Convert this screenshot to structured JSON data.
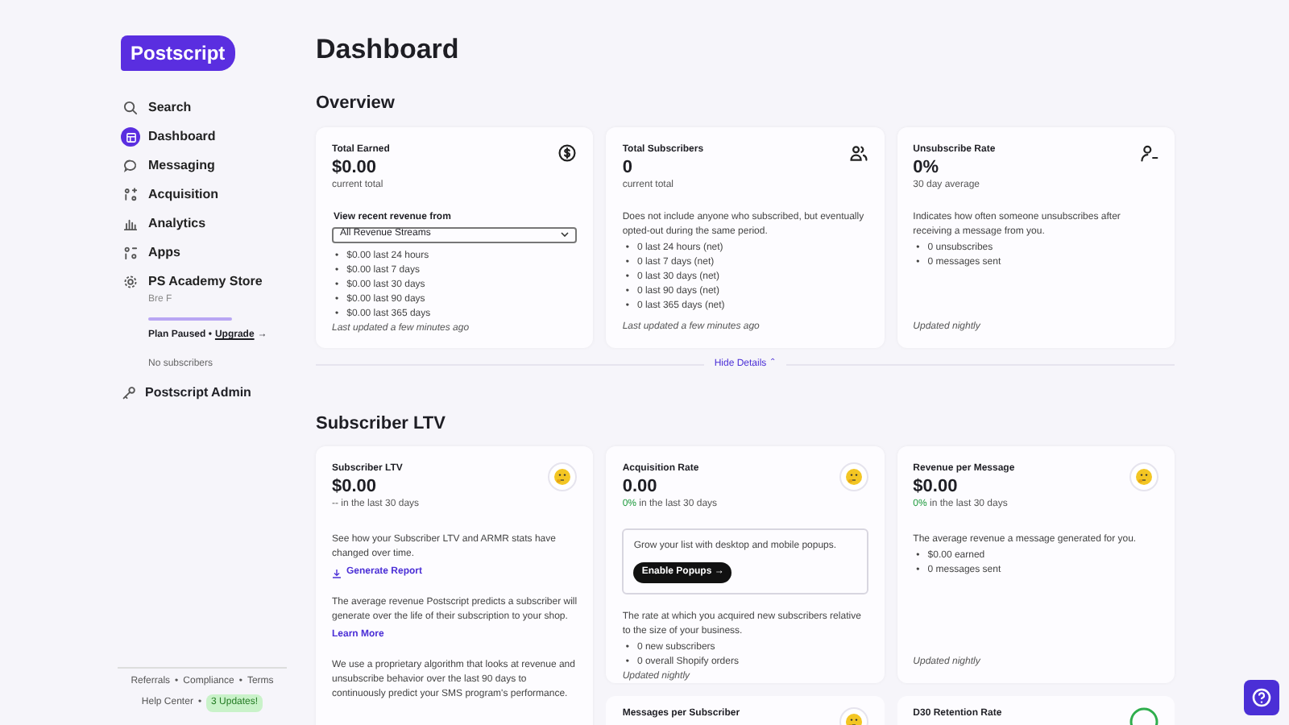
{
  "sidebar": {
    "logo": "Postscript",
    "items": [
      {
        "label": "Search",
        "selected": false
      },
      {
        "label": "Dashboard",
        "selected": true
      },
      {
        "label": "Messaging",
        "selected": false
      },
      {
        "label": "Acquisition",
        "selected": false
      },
      {
        "label": "Analytics",
        "selected": false
      },
      {
        "label": "Apps",
        "selected": false
      },
      {
        "label": "PS Academy Store",
        "selected": false
      }
    ],
    "store": {
      "owner": "Bre F",
      "plan": "Plan Paused •",
      "upgrade": "Upgrade",
      "upgrade_arrow": "→",
      "subscribers": "No subscribers"
    },
    "admin": {
      "label": "Postscript Admin"
    },
    "footer_links": [
      "Referrals",
      "•",
      "Compliance",
      "•",
      "Terms"
    ],
    "help": "Help Center",
    "dot": "•",
    "updates": "3 Updates!"
  },
  "page_title": "Dashboard",
  "overview": {
    "heading": "Overview",
    "cards": [
      {
        "title": "Total Earned",
        "value": "$0.00",
        "caption": "current total",
        "select_label": "View recent revenue from",
        "select_value": "All Revenue Streams",
        "items": [
          {
            "bullet": "•",
            "text": "$0.00 last 24 hours"
          },
          {
            "bullet": "•",
            "text": "$0.00 last 7 days"
          },
          {
            "bullet": "•",
            "text": "$0.00 last 30 days"
          },
          {
            "bullet": "•",
            "text": "$0.00 last 90 days"
          },
          {
            "bullet": "•",
            "text": "$0.00 last 365 days"
          }
        ],
        "footnote": "Last updated a few minutes ago"
      },
      {
        "title": "Total Subscribers",
        "value": "0",
        "caption": "current total",
        "description": "Does not include anyone who subscribed, but eventually opted-out during the same period.",
        "items": [
          {
            "bullet": "•",
            "text": "0 last 24 hours (net)"
          },
          {
            "bullet": "•",
            "text": "0 last 7 days (net)"
          },
          {
            "bullet": "•",
            "text": "0 last 30 days (net)"
          },
          {
            "bullet": "•",
            "text": "0 last 90 days (net)"
          },
          {
            "bullet": "•",
            "text": "0 last 365 days (net)"
          }
        ],
        "footnote": "Last updated a few minutes ago"
      },
      {
        "title": "Unsubscribe Rate",
        "value": "0%",
        "caption": "30 day average",
        "description": "Indicates how often someone unsubscribes after receiving a message from you.",
        "items": [
          {
            "bullet": "•",
            "text": "0 unsubscribes"
          },
          {
            "bullet": "•",
            "text": "0 messages sent"
          }
        ],
        "footnote": "Updated nightly"
      }
    ],
    "toggle": "Hide Details",
    "toggle_icon": "⌃"
  },
  "ltv": {
    "heading": "Subscriber LTV",
    "cards": [
      {
        "kind": "ltv",
        "title": "Subscriber LTV",
        "value": "$0.00",
        "change": "--",
        "caption": "in the last 30 days",
        "paragraph_1": "See how your Subscriber LTV and ARMR stats have changed over time.",
        "report_link": "Generate Report",
        "paragraph_2": "The average revenue Postscript predicts a subscriber will generate over the life of their subscription to your shop.",
        "learn_link": "Learn More",
        "paragraph_3": "We use a proprietary algorithm that looks at revenue and unsubscribe behavior over the last 90 days to continuously predict your SMS program's performance."
      },
      {
        "kind": "acquisition",
        "title": "Acquisition Rate",
        "value": "0.00",
        "change": "0%",
        "caption": "in the last 30 days",
        "promo_text": "Grow your list with desktop and mobile popups.",
        "promo_button": "Enable Popups",
        "promo_arrow": "→",
        "description": "The rate at which you acquired new subscribers relative to the size of your business.",
        "items": [
          {
            "bullet": "•",
            "text": "0 new subscribers"
          },
          {
            "bullet": "•",
            "text": "0 overall Shopify orders"
          }
        ],
        "footnote": "Updated nightly"
      },
      {
        "kind": "revenue",
        "title": "Revenue per Message",
        "value": "$0.00",
        "change": "0%",
        "caption": "in the last 30 days",
        "description": "The average revenue a message generated for you.",
        "items": [
          {
            "bullet": "•",
            "text": "$0.00 earned"
          },
          {
            "bullet": "•",
            "text": "0 messages sent"
          }
        ],
        "footnote": "Updated nightly"
      }
    ],
    "more_cards": [
      {
        "title": "Messages per Subscriber"
      },
      {
        "title": "D30 Retention Rate"
      }
    ]
  }
}
